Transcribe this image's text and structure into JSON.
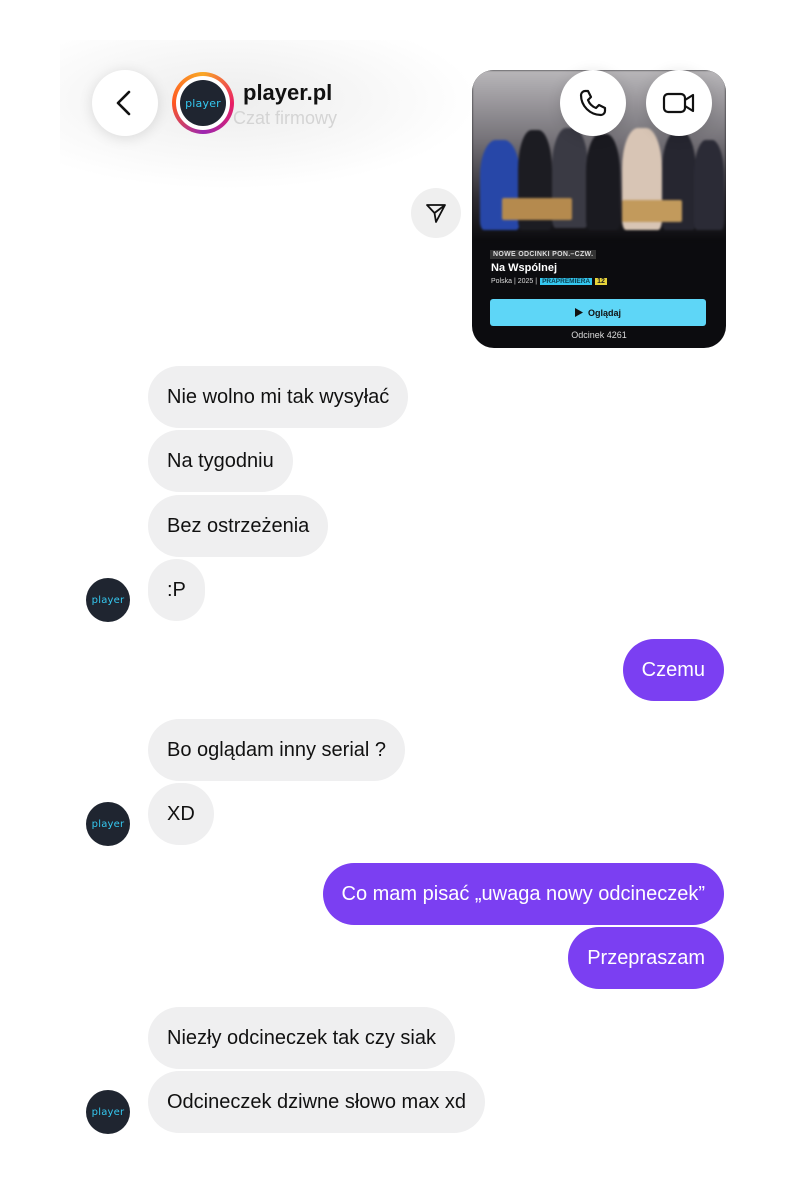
{
  "header": {
    "title": "player.pl",
    "subtitle": "Czat firmowy",
    "avatar_text": "player"
  },
  "media_card": {
    "tag": "NOWE ODCINKI PON.–CZW.",
    "title": "Na Wspólnej",
    "meta": "Polska | 2025 |",
    "premiere_badge": "PRAPREMIERA",
    "age_badge": "12",
    "watch_label": "Oglądaj",
    "episode": "Odcinek 4261"
  },
  "messages": [
    {
      "side": "in",
      "text": "Nie wolno mi tak wysyłać"
    },
    {
      "side": "in",
      "text": "Na tygodniu"
    },
    {
      "side": "in",
      "text": "Bez ostrzeżenia"
    },
    {
      "side": "in",
      "text": ":P"
    },
    {
      "side": "out",
      "text": "Czemu"
    },
    {
      "side": "in",
      "text": "Bo oglądam inny serial ?"
    },
    {
      "side": "in",
      "text": "XD"
    },
    {
      "side": "out",
      "text": "Co mam pisać „uwaga nowy odcineczek”"
    },
    {
      "side": "out",
      "text": "Przepraszam"
    },
    {
      "side": "in",
      "text": "Niezły odcineczek tak czy siak"
    },
    {
      "side": "in",
      "text": "Odcineczek dziwne słowo max xd"
    }
  ],
  "icons": {
    "back": "chevron-left-icon",
    "call": "phone-icon",
    "video": "video-camera-icon",
    "share": "send-icon",
    "play": "play-icon"
  },
  "colors": {
    "outgoing_bubble": "#7b3ff2",
    "incoming_bubble": "#efeff0",
    "watch_button": "#5ed6f7",
    "brand_logo_bg": "#1f2530",
    "brand_logo_text": "#35c8f0"
  }
}
